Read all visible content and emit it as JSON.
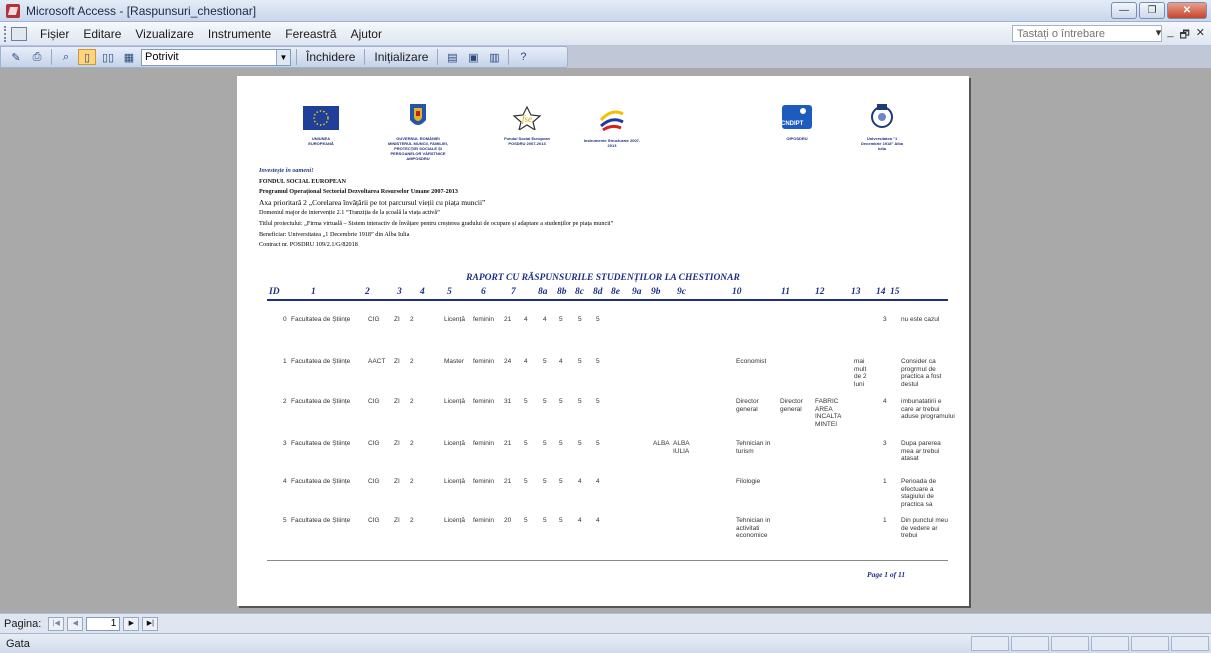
{
  "window": {
    "title": "Microsoft Access - [Raspunsuri_chestionar]",
    "buttons": {
      "minimize": "—",
      "restore": "❐",
      "close": "✕"
    }
  },
  "menu": {
    "items": [
      "Fișier",
      "Editare",
      "Vizualizare",
      "Instrumente",
      "Fereastră",
      "Ajutor"
    ],
    "ask_placeholder": "Tastați o întrebare",
    "mini": [
      "▾",
      "_",
      "🗗",
      "✕"
    ]
  },
  "toolbar": {
    "zoom_value": "Potrivit",
    "close_label": "Închidere",
    "setup_label": "Inițializare"
  },
  "report": {
    "logos": [
      {
        "caption": "UNIUNEA EUROPEANĂ"
      },
      {
        "caption": "GUVERNUL ROMÂNIEI MINISTERUL MUNCII, FAMILIEI, PROTECȚIEI SOCIALE ȘI PERSOANELOR VÂRSTNICE AMPOSDRU"
      },
      {
        "caption": "Fondul Social European POSDRU 2007-2013"
      },
      {
        "caption": "Instrumente Structurale 2007-2013"
      },
      {
        "caption": "OIPOSDRU"
      },
      {
        "caption": "Universitatea \"1 Decembrie 1918\" Alba Iulia"
      }
    ],
    "cndipt_text": "CNDIPT",
    "header": [
      "Investește în oameni!",
      "FONDUL SOCIAL EUROPEAN",
      "Programul Operațional Sectorial Dezvoltarea Resurselor Umane 2007-2013",
      "Axa prioritară 2 „Corelarea învățării pe tot parcursul vieții cu piața muncii”",
      "Domeniul major de intervenție 2.1 “Tranziția de la școală la viața activă”",
      "Titlul proiectului: „Firma virtuală – Sistem interactiv de învățare pentru creșterea gradului de ocupare și adaptare a studenților pe piața muncii”",
      "Beneficiar: Universitatea „1 Decembrie 1918” din Alba Iulia",
      "Contract nr. POSDRU 109/2.1/G/82018"
    ],
    "title": "RAPORT CU RĂSPUNSURILE STUDENȚILOR LA CHESTIONAR",
    "columns": [
      "ID",
      "1",
      "2",
      "3",
      "4",
      "5",
      "6",
      "7",
      "8a",
      "8b",
      "8c",
      "8d",
      "8e",
      "9a",
      "9b",
      "9c",
      "10",
      "11",
      "12",
      "13",
      "14",
      "15"
    ],
    "rows": [
      {
        "id": "0",
        "c1": "Facultatea de Științe",
        "c2": "CIG",
        "c3": "ZI",
        "c4": "2",
        "c5": "Licență",
        "c6": "feminin",
        "c7": "21",
        "c8a": "4",
        "c8b": "4",
        "c8c": "5",
        "c8d": "5",
        "c8e": "5",
        "c9a": "",
        "c9b": "",
        "c10": "",
        "c11": "",
        "c12": "",
        "c13": "",
        "c14": "3",
        "c15": "nu este cazul"
      },
      {
        "id": "1",
        "c1": "Facultatea de Științe",
        "c2": "AACT",
        "c3": "ZI",
        "c4": "2",
        "c5": "Master",
        "c6": "feminin",
        "c7": "24",
        "c8a": "4",
        "c8b": "5",
        "c8c": "4",
        "c8d": "5",
        "c8e": "5",
        "c9a": "",
        "c9b": "",
        "c10": "Economist",
        "c11": "",
        "c12": "",
        "c13": "mai mult de 2 luni",
        "c14": "",
        "c15": "Consider ca progrmul de practica a fost destul"
      },
      {
        "id": "2",
        "c1": "Facultatea de Științe",
        "c2": "CIG",
        "c3": "ZI",
        "c4": "2",
        "c5": "Licență",
        "c6": "feminin",
        "c7": "31",
        "c8a": "5",
        "c8b": "5",
        "c8c": "5",
        "c8d": "5",
        "c8e": "5",
        "c9a": "",
        "c9b": "",
        "c10": "Director general",
        "c11": "Director general",
        "c12": "FABRIC AREA INCALTA MINTEI",
        "c13": "",
        "c14": "4",
        "c15": "imbunatatirii e care ar trebui aduse programului"
      },
      {
        "id": "3",
        "c1": "Facultatea de Științe",
        "c2": "CIG",
        "c3": "ZI",
        "c4": "2",
        "c5": "Licență",
        "c6": "feminin",
        "c7": "21",
        "c8a": "5",
        "c8b": "5",
        "c8c": "5",
        "c8d": "5",
        "c8e": "5",
        "c9a": "ALBA",
        "c9b": "ALBA IULIA",
        "c10": "Tehnician in turism",
        "c11": "",
        "c12": "",
        "c13": "",
        "c14": "3",
        "c15": "Dupa parerea mea ar trebui atasat"
      },
      {
        "id": "4",
        "c1": "Facultatea de Științe",
        "c2": "CIG",
        "c3": "ZI",
        "c4": "2",
        "c5": "Licență",
        "c6": "feminin",
        "c7": "21",
        "c8a": "5",
        "c8b": "5",
        "c8c": "5",
        "c8d": "4",
        "c8e": "4",
        "c9a": "",
        "c9b": "",
        "c10": "Filologie",
        "c11": "",
        "c12": "",
        "c13": "",
        "c14": "1",
        "c15": "Perioada de efectuare a stagiului de practica sa"
      },
      {
        "id": "5",
        "c1": "Facultatea de Științe",
        "c2": "CIG",
        "c3": "ZI",
        "c4": "2",
        "c5": "Licență",
        "c6": "feminin",
        "c7": "20",
        "c8a": "5",
        "c8b": "5",
        "c8c": "5",
        "c8d": "4",
        "c8e": "4",
        "c9a": "",
        "c9b": "",
        "c10": "Tehnician in activitati economice",
        "c11": "",
        "c12": "",
        "c13": "",
        "c14": "1",
        "c15": "Din punctul meu de vedere ar trebui"
      }
    ],
    "page_label": "Page 1 of 11"
  },
  "navigation": {
    "label": "Pagina:",
    "current_page": "1"
  },
  "status": {
    "text": "Gata"
  }
}
